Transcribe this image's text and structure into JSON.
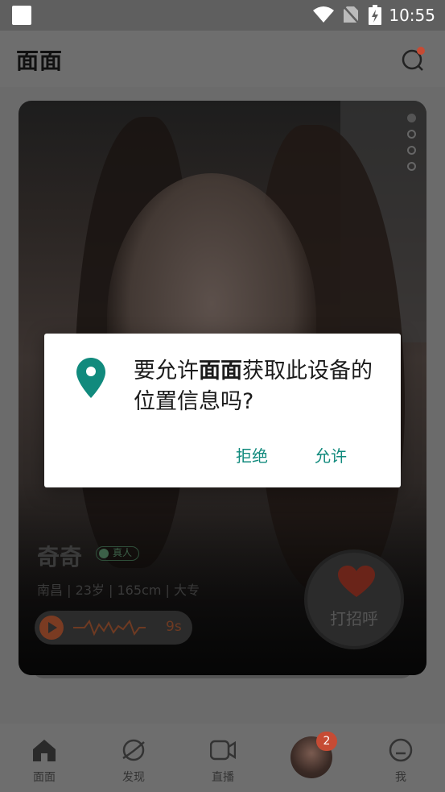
{
  "status_bar": {
    "time": "10:55"
  },
  "header": {
    "title": "面面"
  },
  "profile": {
    "name": "奇奇",
    "verified_label": "真人",
    "details": "南昌 | 23岁 | 165cm | 大专",
    "voice_duration": "9s",
    "greet_label": "打招呼",
    "photo_index": 1,
    "photo_count": 4
  },
  "bottom_nav": {
    "items": [
      {
        "label": "面面",
        "icon": "home-icon"
      },
      {
        "label": "发现",
        "icon": "planet-icon"
      },
      {
        "label": "直播",
        "icon": "video-camera-icon"
      },
      {
        "label": "",
        "icon": "avatar"
      },
      {
        "label": "我",
        "icon": "smile-face-icon"
      }
    ],
    "badge_count": "2"
  },
  "dialog": {
    "message_prefix": "要允许",
    "message_app": "面面",
    "message_suffix": "获取此设备的位置信息吗?",
    "deny_label": "拒绝",
    "allow_label": "允许"
  },
  "colors": {
    "accent": "#118a7d",
    "badge": "#c64b34",
    "heart": "#d23a28"
  }
}
